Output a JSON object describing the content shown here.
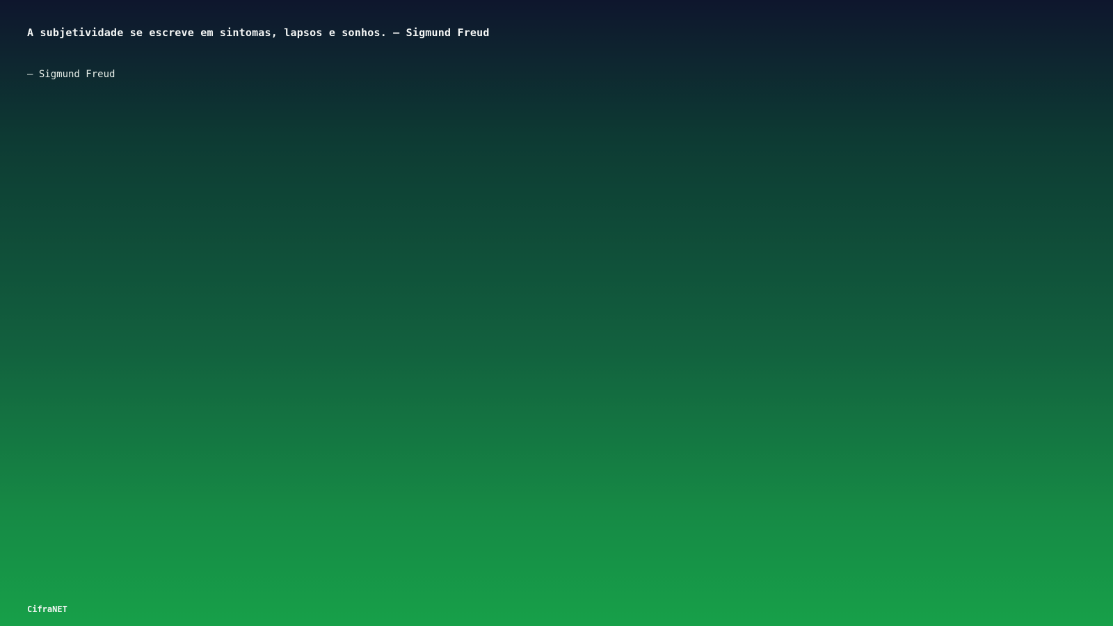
{
  "quote": {
    "text": "A subjetividade se escreve em sintomas, lapsos e sonhos. — Sigmund Freud",
    "author": "— Sigmund Freud"
  },
  "footer": {
    "brand": "CifraNET"
  },
  "colors": {
    "gradient_top": "#0e162d",
    "gradient_bottom": "#17a049",
    "text": "#f2f5f3"
  }
}
